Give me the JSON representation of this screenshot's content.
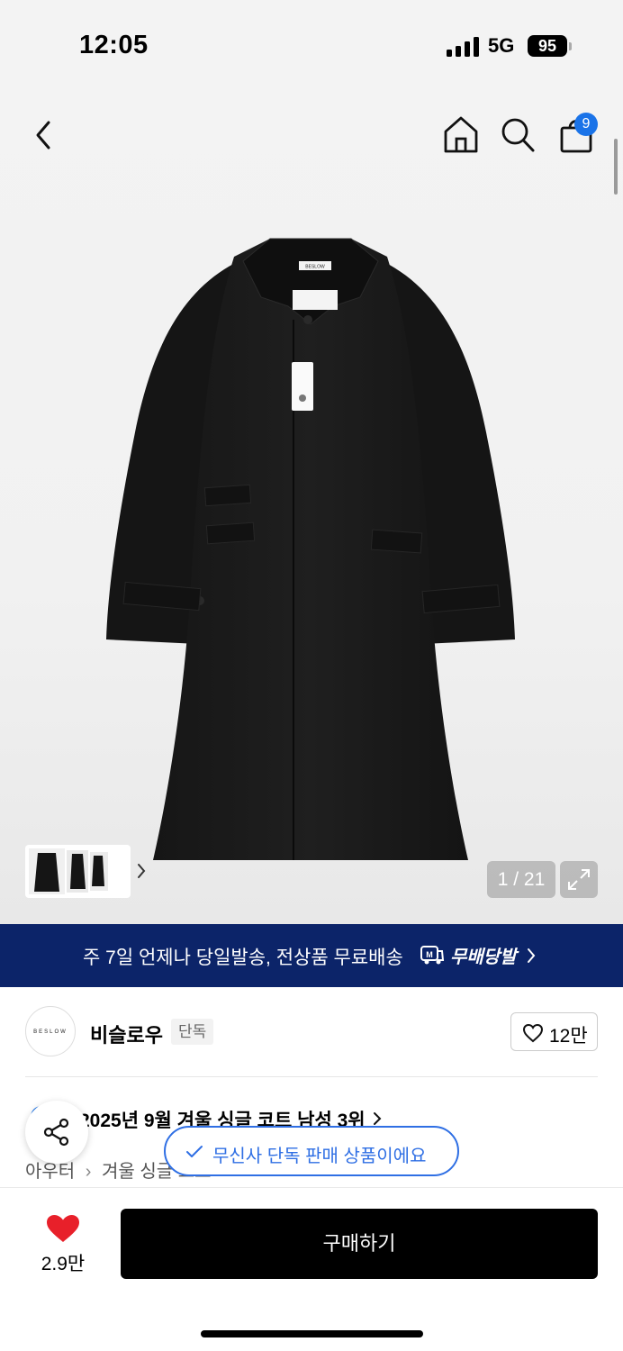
{
  "status_bar": {
    "time": "12:05",
    "network": "5G",
    "battery": "95"
  },
  "header": {
    "back_icon": "chevron-left-icon",
    "home_icon": "home-icon",
    "search_icon": "search-icon",
    "cart_icon": "shopping-bag-icon",
    "cart_count": "9"
  },
  "gallery": {
    "counter": "1 / 21",
    "expand_icon": "expand-icon",
    "coat_label": "BESLOW"
  },
  "promo": {
    "text": "주 7일 언제나 당일발송, 전상품 무료배송",
    "brand": "무배당발",
    "background": "#0c2469"
  },
  "brand": {
    "logo_text": "BESLOW",
    "name": "비슬로우",
    "tag": "단독",
    "likes": "12만"
  },
  "ranking": {
    "text": "2025년 9월 겨울 싱글 코트 남성 3위"
  },
  "breadcrumb": [
    "아우터",
    "겨울 싱글 코트"
  ],
  "exclusive_notice": "무신사 단독 판매 상품이에요",
  "bottom": {
    "wish_count": "2.9만",
    "buy_label": "구매하기"
  },
  "colors": {
    "accent_blue": "#2f6fe4",
    "wish_red": "#e8202a"
  }
}
